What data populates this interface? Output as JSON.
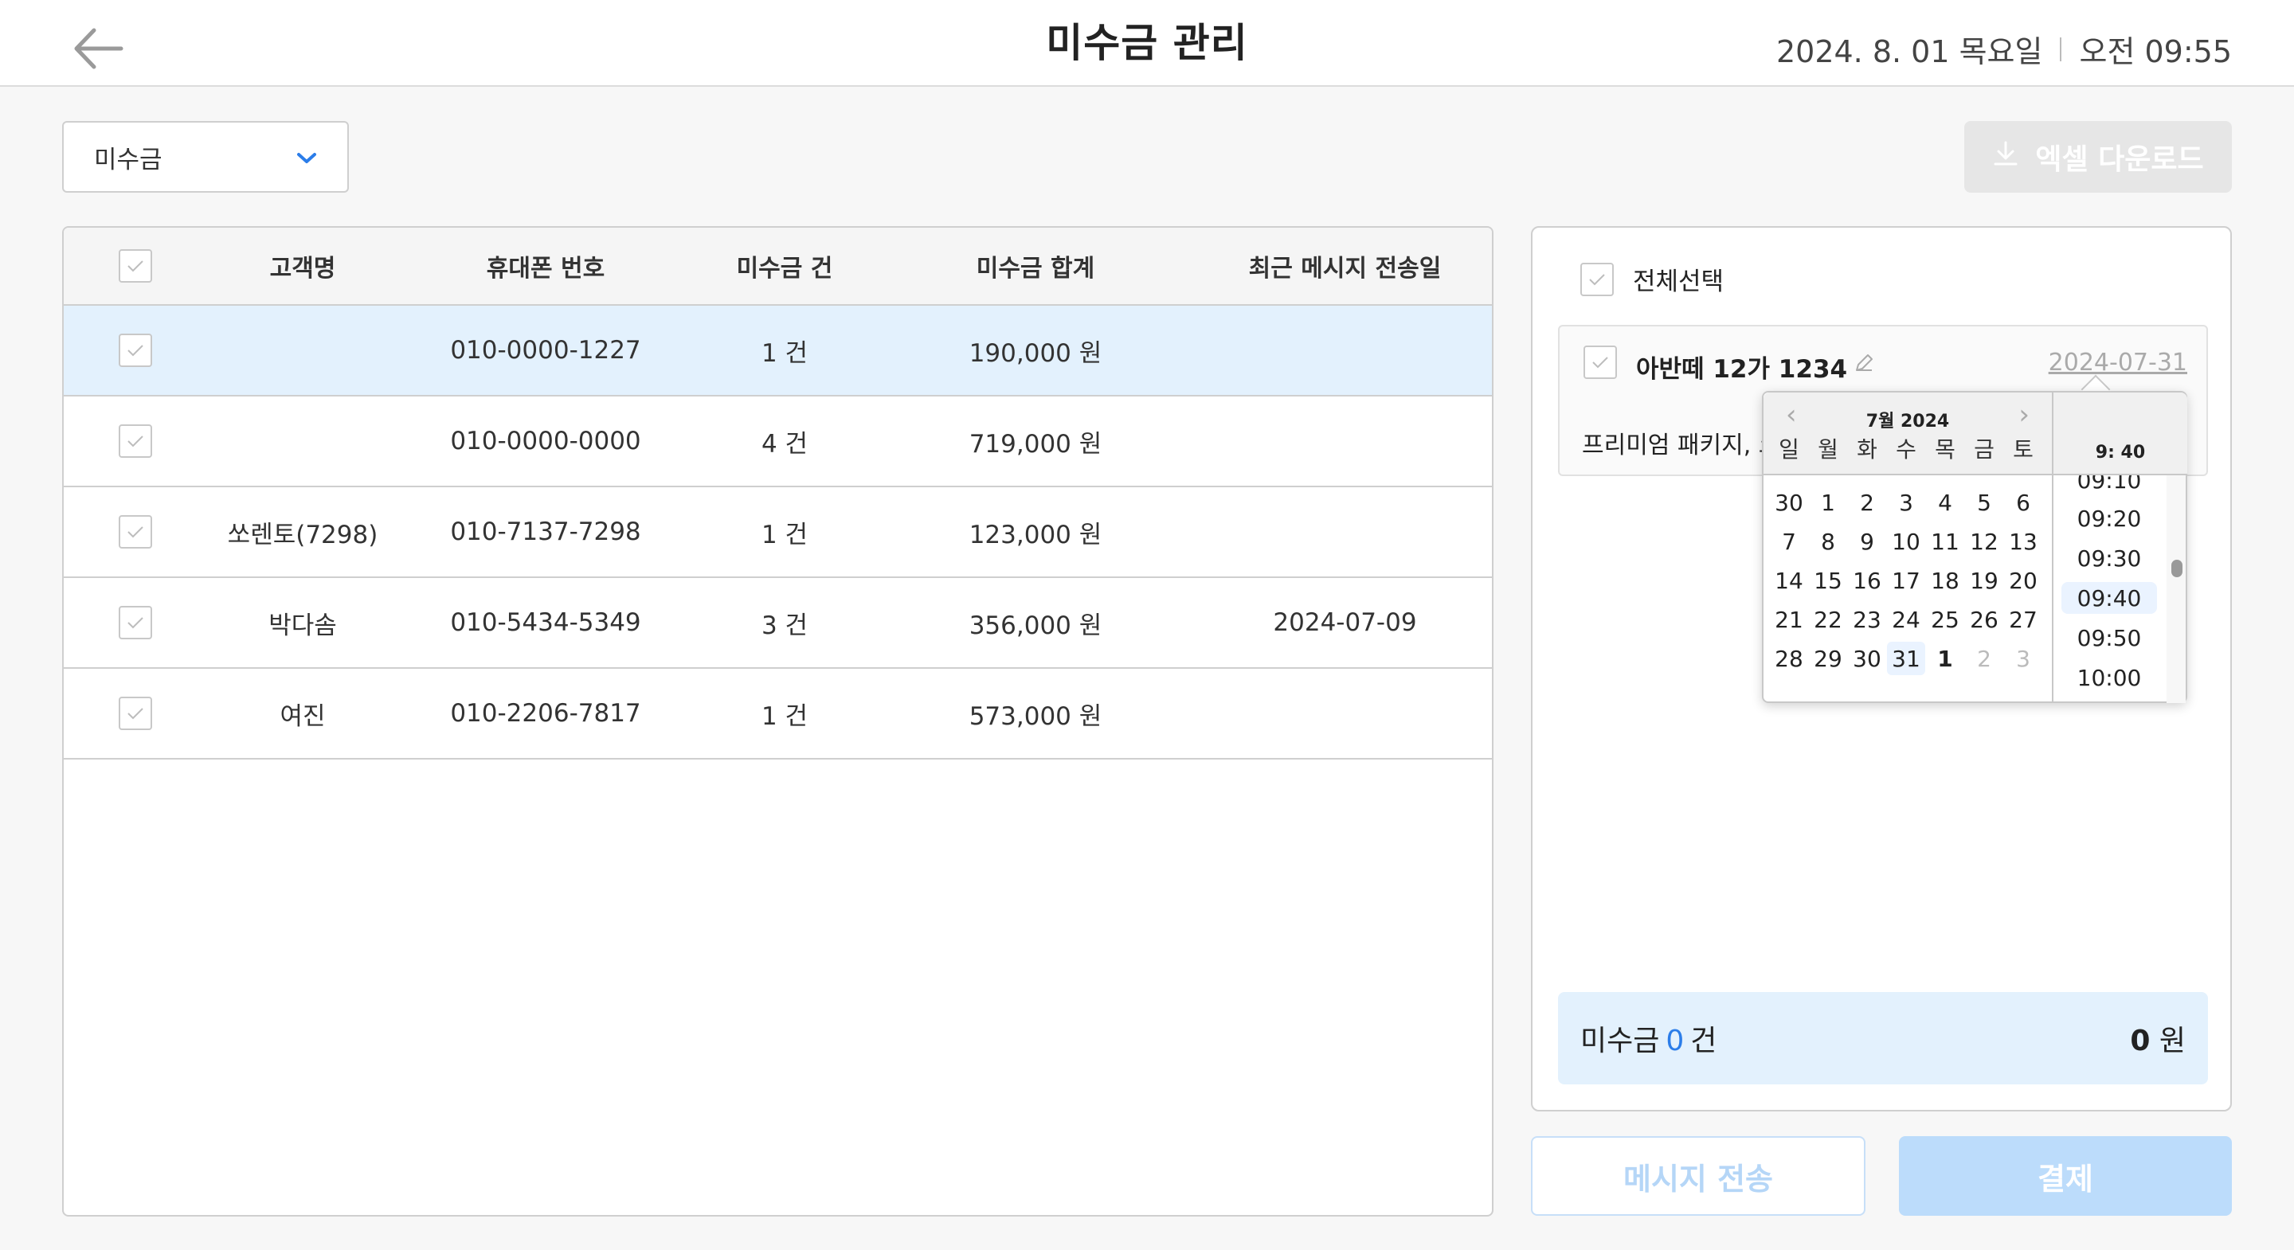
{
  "header": {
    "title": "미수금 관리",
    "date": "2024. 8. 01 목요일",
    "time": "오전 09:55"
  },
  "toolbar": {
    "filter_value": "미수금",
    "excel_label": "엑셀 다운로드"
  },
  "table": {
    "columns": [
      "고객명",
      "휴대폰 번호",
      "미수금 건",
      "미수금 합계",
      "최근 메시지 전송일"
    ],
    "rows": [
      {
        "name": "",
        "phone": "010-0000-1227",
        "count": "1 건",
        "sum": "190,000 원",
        "last_sent": ""
      },
      {
        "name": "",
        "phone": "010-0000-0000",
        "count": "4 건",
        "sum": "719,000 원",
        "last_sent": ""
      },
      {
        "name": "쏘렌토(7298)",
        "phone": "010-7137-7298",
        "count": "1 건",
        "sum": "123,000 원",
        "last_sent": ""
      },
      {
        "name": "박다솜",
        "phone": "010-5434-5349",
        "count": "3 건",
        "sum": "356,000 원",
        "last_sent": "2024-07-09"
      },
      {
        "name": "여진",
        "phone": "010-2206-7817",
        "count": "1 건",
        "sum": "573,000 원",
        "last_sent": ""
      }
    ]
  },
  "detail": {
    "select_all_label": "전체선택",
    "card": {
      "car": "아반떼 12가 1234",
      "date": "2024-07-31",
      "desc": "프리미엄 패키지, 코"
    },
    "summary": {
      "prefix": "미수금",
      "count": "0",
      "unit": "건",
      "amount_value": "0",
      "amount_unit": "원"
    }
  },
  "picker": {
    "title": "7월 2024",
    "weekdays": [
      "일",
      "월",
      "화",
      "수",
      "목",
      "금",
      "토"
    ],
    "weeks": [
      [
        "30",
        "1",
        "2",
        "3",
        "4",
        "5",
        "6"
      ],
      [
        "7",
        "8",
        "9",
        "10",
        "11",
        "12",
        "13"
      ],
      [
        "14",
        "15",
        "16",
        "17",
        "18",
        "19",
        "20"
      ],
      [
        "21",
        "22",
        "23",
        "24",
        "25",
        "26",
        "27"
      ],
      [
        "28",
        "29",
        "30",
        "31",
        "1",
        "2",
        "3"
      ]
    ],
    "time_header": "9: 40",
    "time_slots": [
      "09:10",
      "09:20",
      "09:30",
      "09:40",
      "09:50",
      "10:00"
    ],
    "selected_time": "09:40"
  },
  "actions": {
    "message_label": "메시지 전송",
    "pay_label": "결제"
  },
  "colors": {
    "accent": "#2b7de9",
    "selected_row": "#e3f1fd",
    "pay_button": "#bcdcfb"
  }
}
